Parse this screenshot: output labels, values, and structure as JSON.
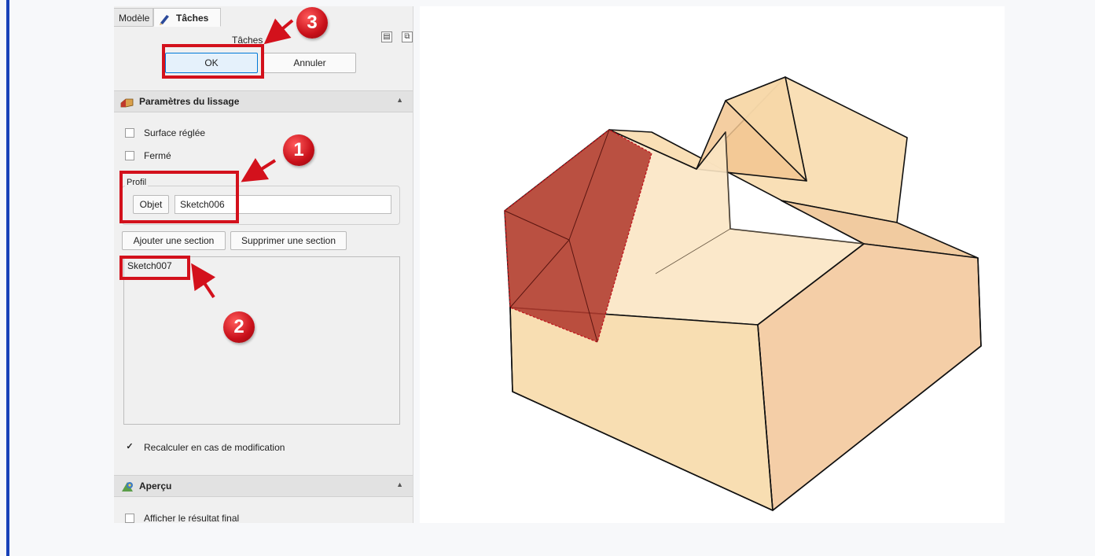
{
  "tabs": {
    "model": "Modèle",
    "tasks": "Tâches"
  },
  "tasks_header": {
    "label": "Tâches"
  },
  "buttons": {
    "ok": "OK",
    "cancel": "Annuler"
  },
  "loft": {
    "title": "Paramètres du lissage",
    "ruled_surface": "Surface réglée",
    "closed": "Fermé",
    "profile_label": "Profil",
    "object_button": "Objet",
    "profile_value": "Sketch006",
    "add_section": "Ajouter une section",
    "remove_section": "Supprimer une section",
    "sections": [
      "Sketch007"
    ],
    "recompute": "Recalculer en cas de modification",
    "recompute_checked": true
  },
  "preview": {
    "title": "Aperçu",
    "show_final": "Afficher le résultat final"
  },
  "annotations": {
    "badge1": "1",
    "badge2": "2",
    "badge3": "3"
  },
  "colors": {
    "annotation": "#d3111c",
    "solid_face": "#f8dcae",
    "selected_face": "#b03a2e",
    "accent": "#0078d7"
  },
  "icons": [
    "pencil-icon",
    "loft-icon",
    "preview-icon",
    "collapse-icon",
    "restore-icon",
    "chevron-up-icon",
    "checkmark-icon",
    "arrow-icon"
  ]
}
